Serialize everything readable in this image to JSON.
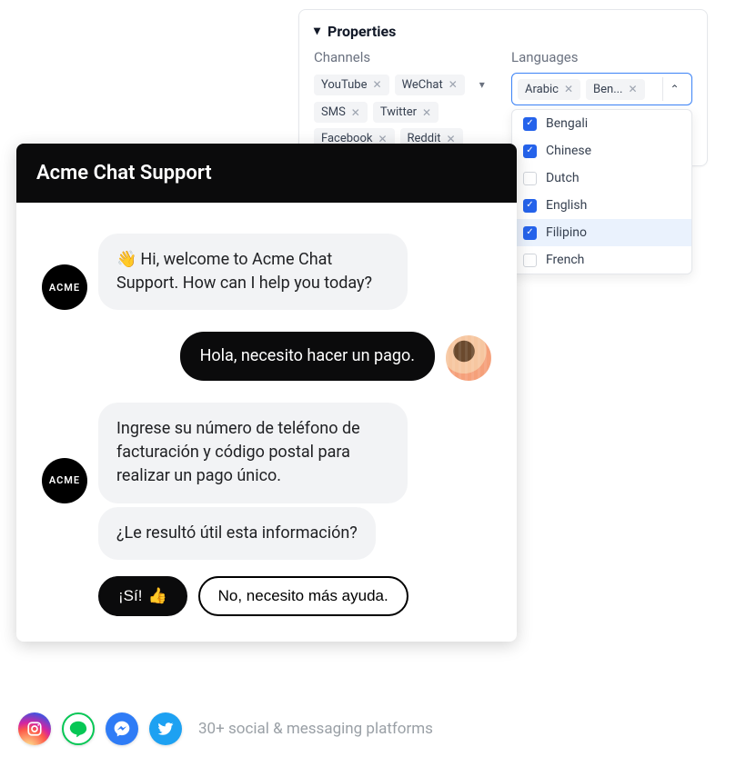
{
  "properties": {
    "title": "Properties",
    "channels": {
      "title": "Channels",
      "tags": [
        "YouTube",
        "WeChat",
        "SMS",
        "Twitter",
        "Facebook",
        "Reddit"
      ]
    },
    "languages": {
      "title": "Languages",
      "selected": [
        "Arabic",
        "Ben..."
      ],
      "options": [
        {
          "label": "Bengali",
          "checked": true,
          "highlight": false
        },
        {
          "label": "Chinese",
          "checked": true,
          "highlight": false
        },
        {
          "label": "Dutch",
          "checked": false,
          "highlight": false
        },
        {
          "label": "English",
          "checked": true,
          "highlight": false
        },
        {
          "label": "Filipino",
          "checked": true,
          "highlight": true
        },
        {
          "label": "French",
          "checked": false,
          "highlight": false
        }
      ]
    }
  },
  "chat": {
    "title": "Acme Chat Support",
    "agent_label": "ACME",
    "messages": {
      "welcome": "Hi, welcome to Acme Chat Support. How can I help you today?",
      "user1": "Hola, necesito hacer un pago.",
      "agent2": "Ingrese su número de teléfono de facturación y código postal para realizar un pago único.",
      "followup": "¿Le resultó útil esta información?"
    },
    "buttons": {
      "yes": "¡Sí!",
      "no": "No, necesito más ayuda."
    }
  },
  "footer": {
    "text": "30+ social & messaging platforms"
  }
}
